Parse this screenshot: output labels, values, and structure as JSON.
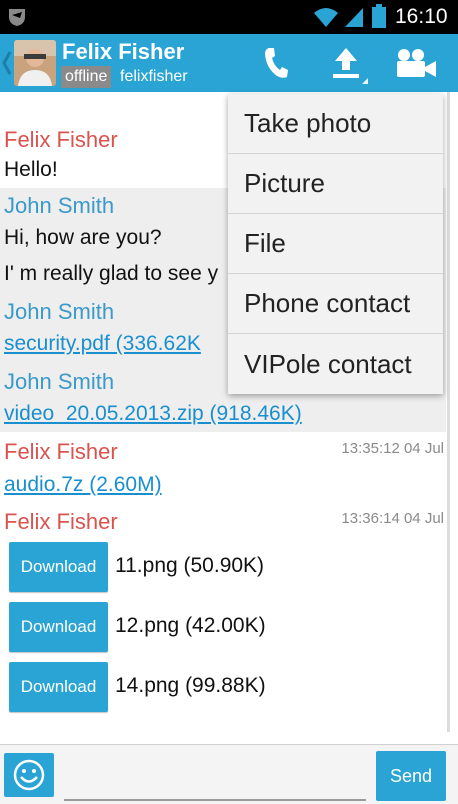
{
  "status_bar": {
    "time": "16:10"
  },
  "action_bar": {
    "contact_name": "Felix Fisher",
    "status": "offline",
    "login": "felixfisher"
  },
  "menu": {
    "items": [
      "Take photo",
      "Picture",
      "File",
      "Phone contact",
      "VIPole contact"
    ]
  },
  "messages": [
    {
      "sender": "Felix Fisher",
      "text": "Hello!"
    },
    {
      "sender": "John Smith",
      "lines": [
        "Hi, how are you?",
        "I' m really glad to see y"
      ]
    },
    {
      "sender": "John Smith",
      "file": "security.pdf (336.62K"
    },
    {
      "sender": "John Smith",
      "file": "video_20.05.2013.zip (918.46K)"
    },
    {
      "sender": "Felix Fisher",
      "timestamp": "13:35:12 04 Jul",
      "file": "audio.7z (2.60M)"
    },
    {
      "sender": "Felix Fisher",
      "timestamp": "13:36:14 04 Jul",
      "downloads": [
        {
          "button": "Download",
          "file": "11.png (50.90K)"
        },
        {
          "button": "Download",
          "file": "12.png (42.00K)"
        },
        {
          "button": "Download",
          "file": "14.png (99.88K)"
        }
      ]
    }
  ],
  "input_bar": {
    "placeholder": "",
    "send_label": "Send"
  },
  "colors": {
    "accent": "#2aa4d4",
    "felix_name": "#d9534f",
    "john_name": "#3a9ac9",
    "link": "#1a8fd0"
  },
  "icons": [
    "app-logo-icon",
    "wifi-icon",
    "signal-icon",
    "battery-icon",
    "back-chevron-icon",
    "phone-icon",
    "upload-icon",
    "video-camera-icon",
    "emoji-icon"
  ]
}
